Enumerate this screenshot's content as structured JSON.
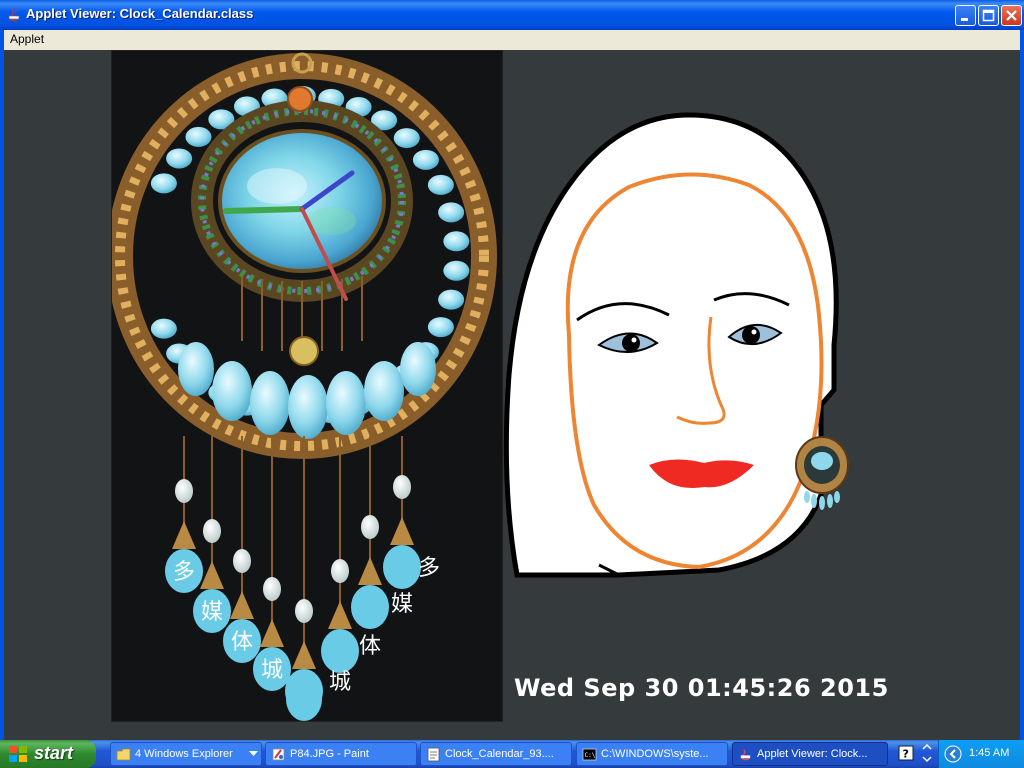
{
  "window": {
    "title": "Applet Viewer: Clock_Calendar.class"
  },
  "menu": {
    "items": [
      "Applet"
    ]
  },
  "applet": {
    "background_color": "#353a3c",
    "datetime_text": "Wed Sep 30 01:45:26 2015",
    "clock_chars": [
      "多",
      "媒",
      "体",
      "城",
      "城",
      "体",
      "媒",
      "多"
    ]
  },
  "taskbar": {
    "start_label": "start",
    "tasks": [
      {
        "label": "4 Windows Explorer",
        "icon": "folder-icon"
      },
      {
        "label": "P84.JPG - Paint",
        "icon": "paint-icon"
      },
      {
        "label": "Clock_Calendar_93....",
        "icon": "notepad-icon"
      },
      {
        "label": "C:\\WINDOWS\\syste...",
        "icon": "console-icon"
      },
      {
        "label": "Applet Viewer: Clock...",
        "icon": "java-icon"
      }
    ],
    "clock": "1:45 AM"
  }
}
